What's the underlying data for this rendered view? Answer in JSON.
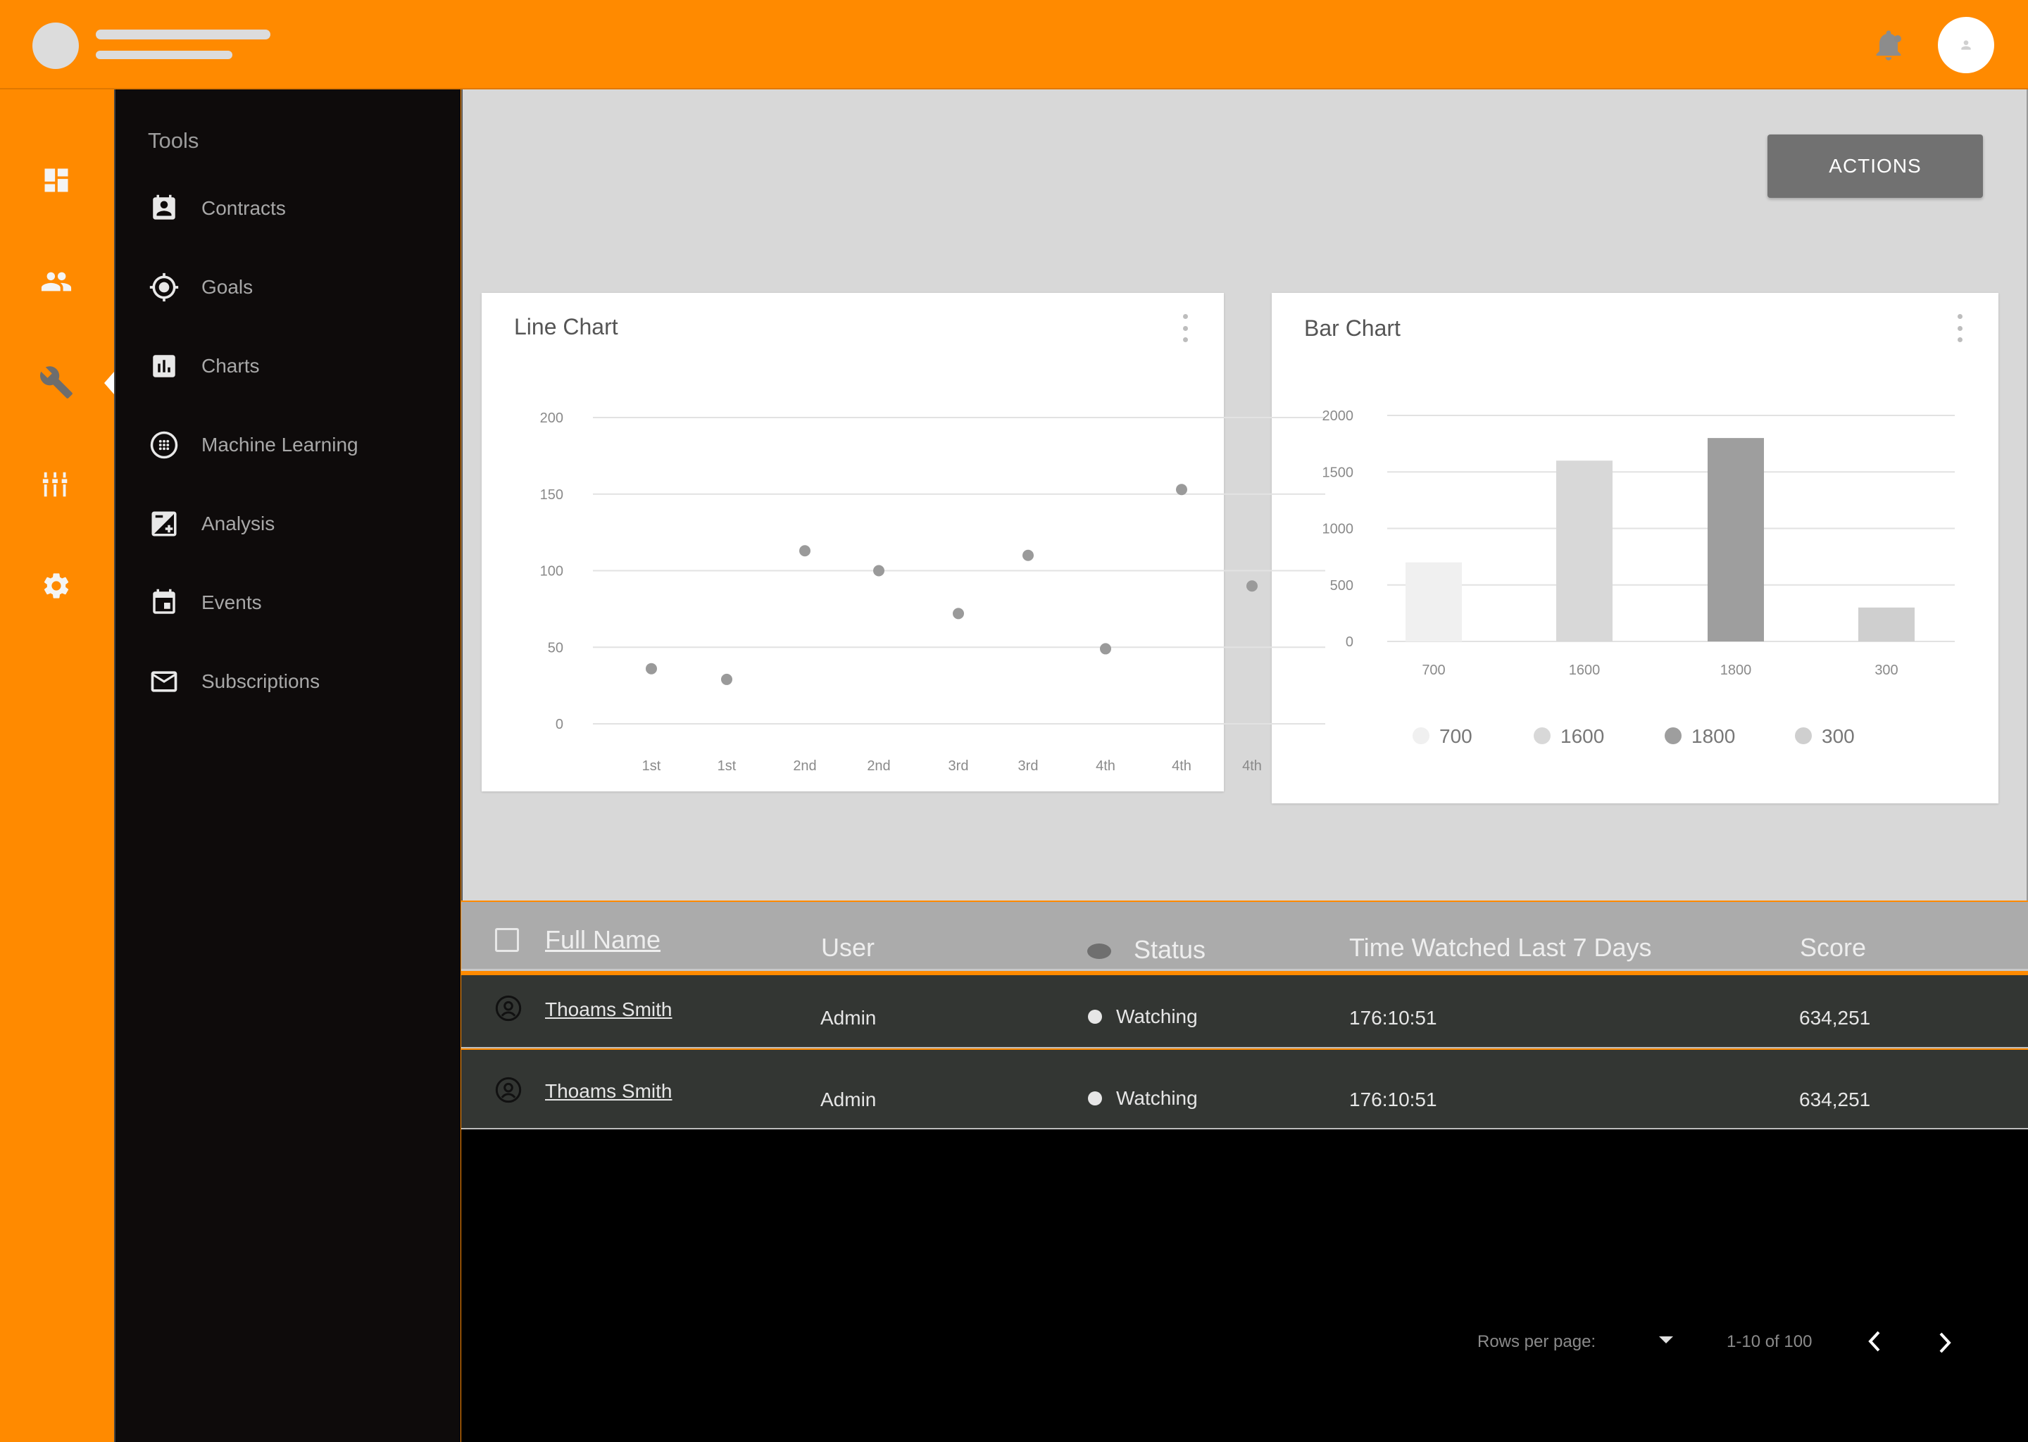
{
  "header": {
    "notification_icon": "bell-icon",
    "avatar_icon": "person-icon"
  },
  "rail": {
    "items": [
      {
        "icon": "dashboard-icon",
        "name": "dashboard"
      },
      {
        "icon": "people-icon",
        "name": "people"
      },
      {
        "icon": "wrench-icon",
        "name": "tools",
        "active": true
      },
      {
        "icon": "equalizer-icon",
        "name": "equalizer"
      },
      {
        "icon": "gear-icon",
        "name": "settings"
      }
    ]
  },
  "sidebar": {
    "section_title": "Tools",
    "items": [
      {
        "label": "Contracts",
        "icon": "contract-icon"
      },
      {
        "label": "Goals",
        "icon": "target-icon"
      },
      {
        "label": "Charts",
        "icon": "bar-chart-icon"
      },
      {
        "label": "Machine Learning",
        "icon": "dots-circle-icon"
      },
      {
        "label": "Analysis",
        "icon": "exposure-icon"
      },
      {
        "label": "Events",
        "icon": "calendar-icon"
      },
      {
        "label": "Subscriptions",
        "icon": "mail-icon"
      }
    ]
  },
  "main": {
    "actions_label": "ACTIONS"
  },
  "line_card": {
    "title": "Line Chart"
  },
  "bar_card": {
    "title": "Bar Chart"
  },
  "chart_data": [
    {
      "type": "scatter",
      "title": "Line Chart",
      "categories": [
        "1st",
        "1st",
        "2nd",
        "2nd",
        "3rd",
        "3rd",
        "4th",
        "4th",
        "4th"
      ],
      "values": [
        36,
        29,
        113,
        100,
        72,
        110,
        49,
        153,
        90
      ],
      "yticks": [
        0,
        50,
        100,
        150,
        200
      ],
      "ylim": [
        0,
        200
      ],
      "grid": true,
      "colors": [
        "#9a9a9a"
      ]
    },
    {
      "type": "bar",
      "title": "Bar Chart",
      "categories": [
        "700",
        "1600",
        "1800",
        "300"
      ],
      "values": [
        700,
        1600,
        1800,
        300
      ],
      "yticks": [
        0,
        500,
        1000,
        1500,
        2000
      ],
      "ylim": [
        0,
        2000
      ],
      "grid": true,
      "legend": [
        "700",
        "1600",
        "1800",
        "300"
      ],
      "legend_position": "bottom",
      "colors": [
        "#f0f0f0",
        "#d8d8d8",
        "#9e9e9e",
        "#cfcfcf"
      ]
    }
  ],
  "table": {
    "headers": {
      "full_name": "Full Name",
      "user": "User",
      "status": "Status",
      "time": "Time Watched Last 7 Days",
      "score": "Score"
    },
    "rows": [
      {
        "full_name": "Thoams Smith",
        "user": "Admin",
        "status": "Watching",
        "time": "176:10:51",
        "score": "634,251"
      },
      {
        "full_name": "Thoams Smith",
        "user": "Admin",
        "status": "Watching",
        "time": "176:10:51",
        "score": "634,251"
      }
    ],
    "footer": {
      "rows_per_page_label": "Rows per page:",
      "range": "1-10 of 100",
      "prev_icon": "chevron-left-icon",
      "next_icon": "chevron-right-icon",
      "dropdown_icon": "caret-down-icon"
    }
  },
  "colors": {
    "brand": "#ff8a00",
    "sidebar": "#0e0b0b",
    "panel": "#d8d8d8",
    "row": "#333633"
  }
}
